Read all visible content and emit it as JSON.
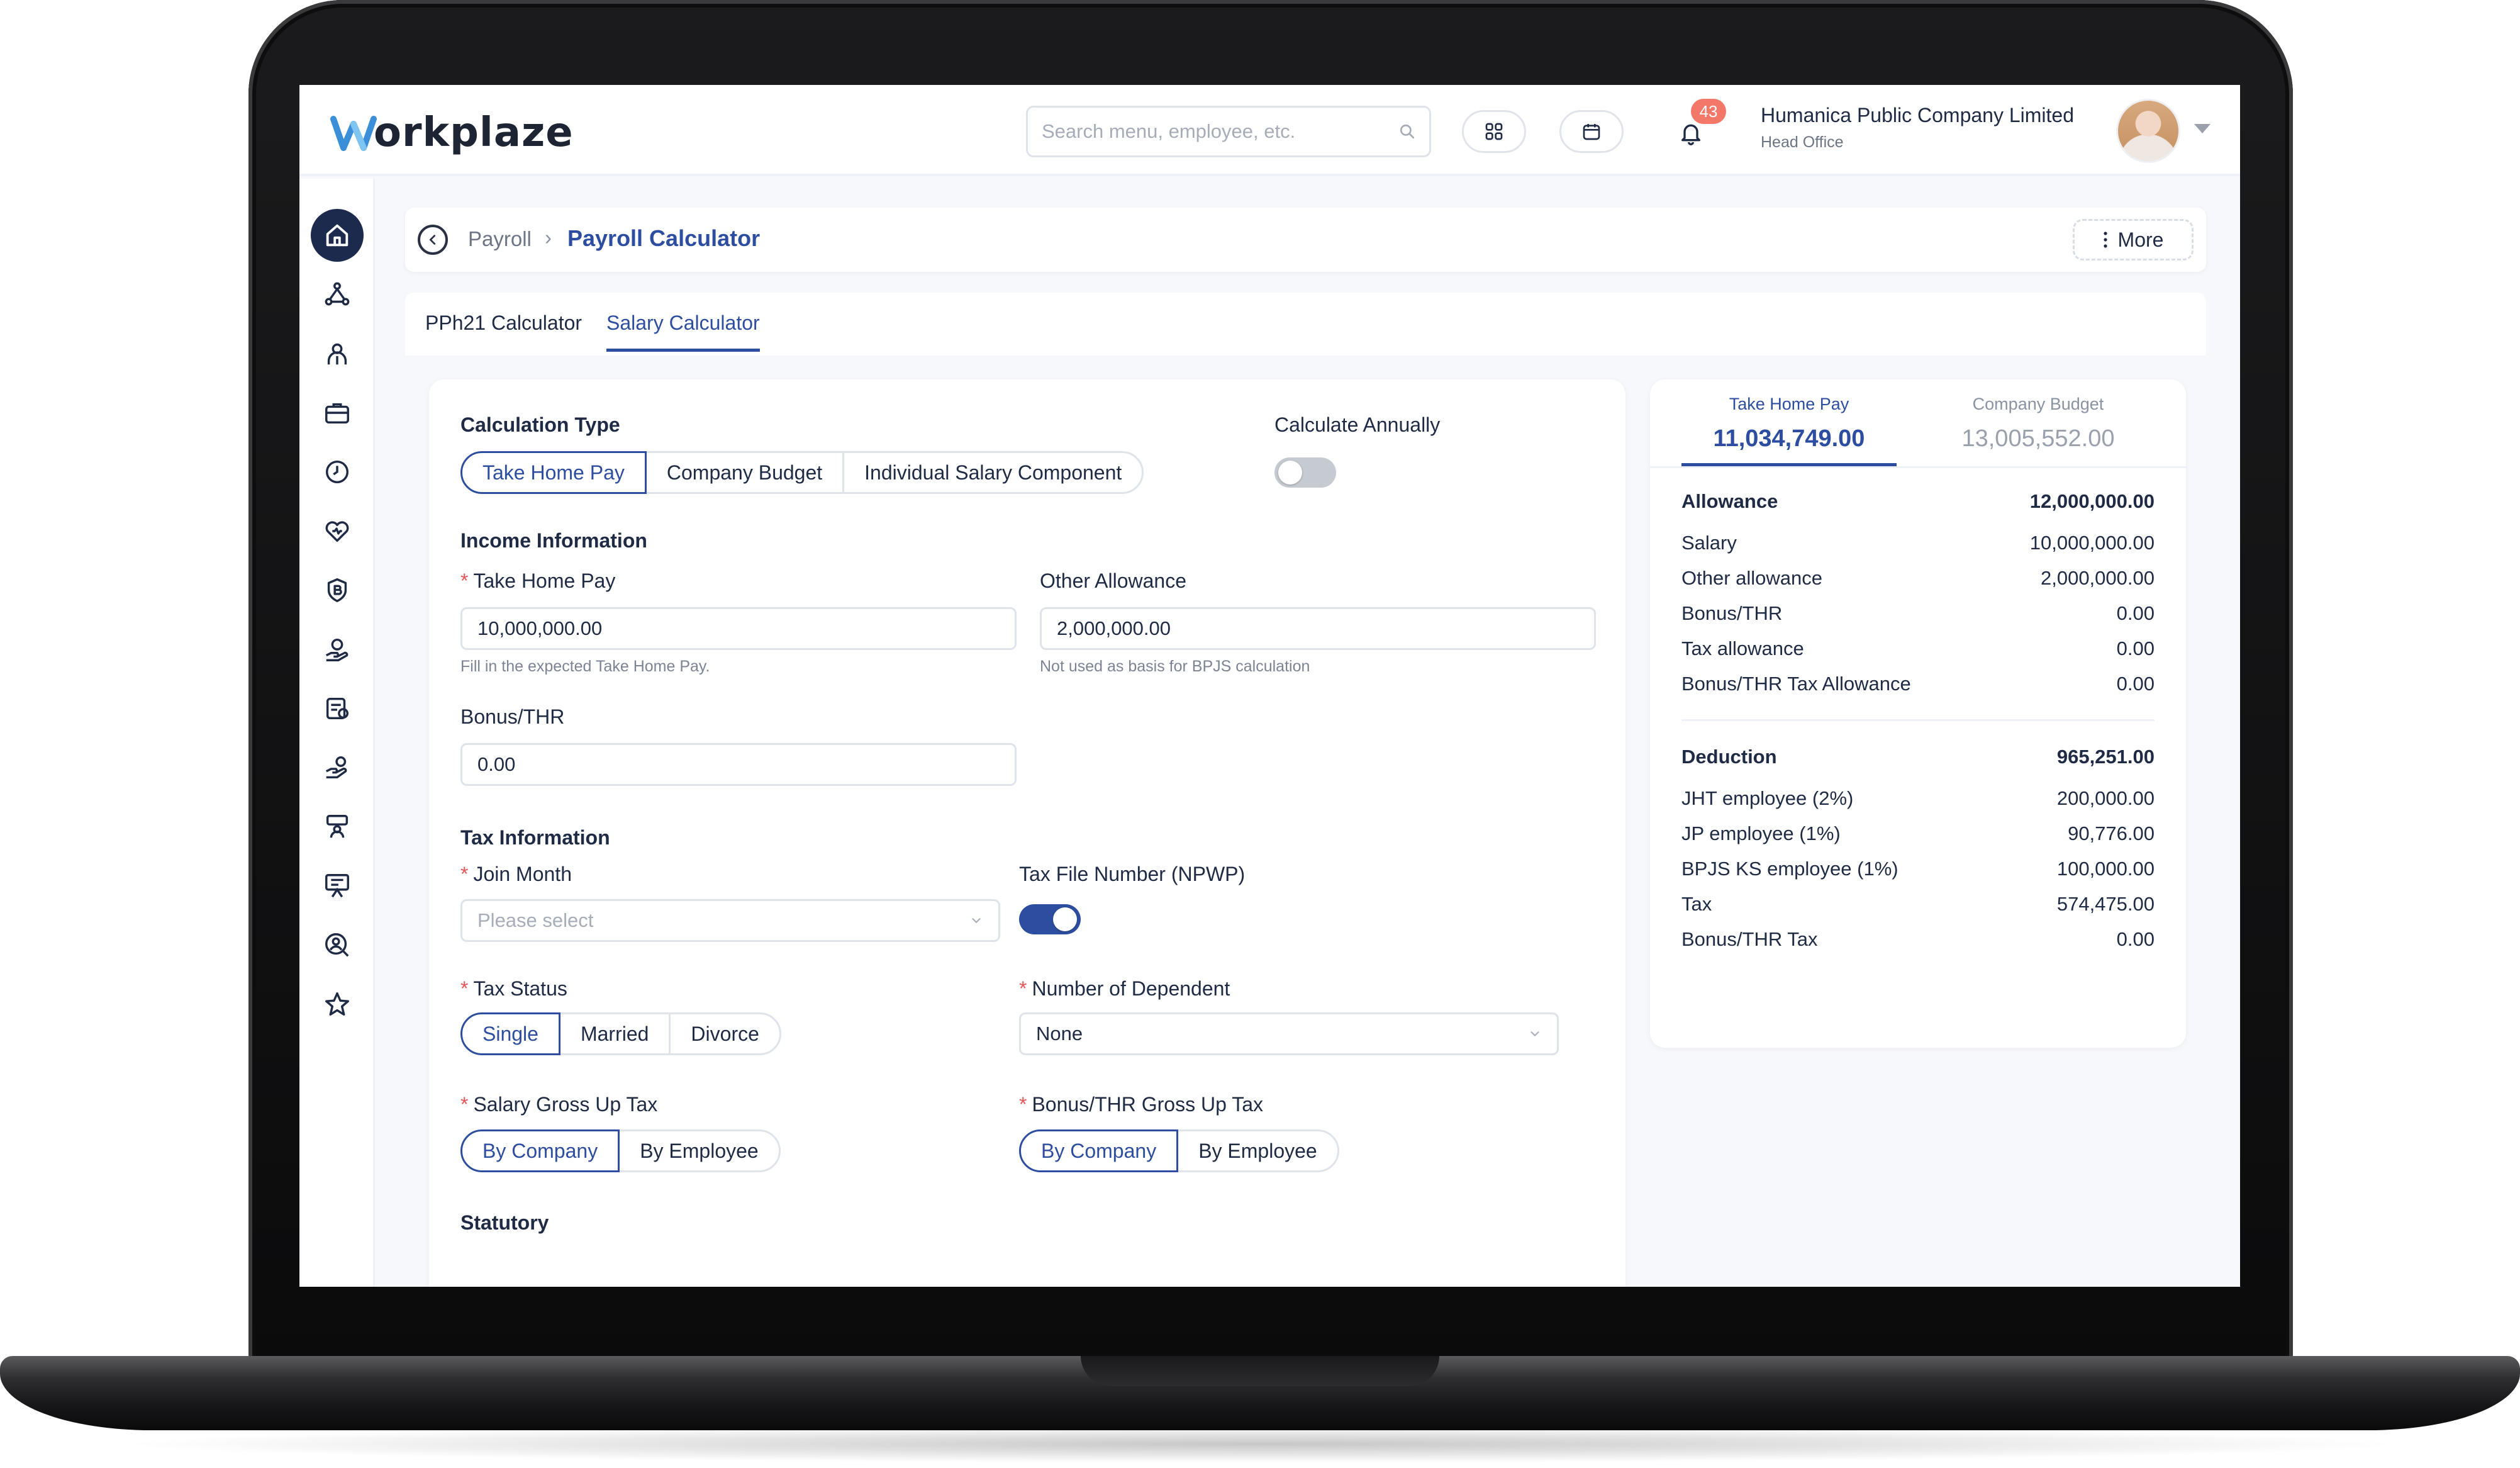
{
  "app": {
    "logo_text": "orkplaze"
  },
  "header": {
    "search_placeholder": "Search menu, employee, etc.",
    "notification_count": "43",
    "company_name": "Humanica Public Company Limited",
    "company_branch": "Head Office"
  },
  "breadcrumb": {
    "parent": "Payroll",
    "separator": "›",
    "current": "Payroll Calculator",
    "more_label": "More"
  },
  "tabs": [
    {
      "label": "PPh21 Calculator",
      "active": false
    },
    {
      "label": "Salary Calculator",
      "active": true
    }
  ],
  "form": {
    "calculation_type": {
      "title": "Calculation Type",
      "options": [
        "Take Home Pay",
        "Company Budget",
        "Individual Salary Component"
      ],
      "selected": "Take Home Pay"
    },
    "calculate_annually": {
      "label": "Calculate Annually",
      "on": false
    },
    "income": {
      "title": "Income Information",
      "take_home_pay": {
        "label": "Take Home Pay",
        "value": "10,000,000.00",
        "helper": "Fill in the expected Take Home Pay."
      },
      "other_allowance": {
        "label": "Other Allowance",
        "value": "2,000,000.00",
        "helper": "Not used as basis for BPJS calculation"
      },
      "bonus_thr": {
        "label": "Bonus/THR",
        "value": "0.00"
      }
    },
    "tax": {
      "title": "Tax Information",
      "join_month": {
        "label": "Join Month",
        "placeholder": "Please select"
      },
      "npwp": {
        "label": "Tax File Number (NPWP)",
        "on": true
      },
      "tax_status": {
        "label": "Tax Status",
        "options": [
          "Single",
          "Married",
          "Divorce"
        ],
        "selected": "Single"
      },
      "dependents": {
        "label": "Number of Dependent",
        "value": "None"
      },
      "salary_gross_up": {
        "label": "Salary Gross Up Tax",
        "options": [
          "By Company",
          "By Employee"
        ],
        "selected": "By Company"
      },
      "bonus_gross_up": {
        "label": "Bonus/THR Gross Up Tax",
        "options": [
          "By Company",
          "By Employee"
        ],
        "selected": "By Company"
      }
    },
    "statutory": {
      "title": "Statutory"
    },
    "required_marker": "*"
  },
  "summary": {
    "tabs": [
      {
        "label": "Take Home Pay",
        "amount": "11,034,749.00",
        "active": true
      },
      {
        "label": "Company Budget",
        "amount": "13,005,552.00",
        "active": false
      }
    ],
    "allowance": {
      "title": "Allowance",
      "total": "12,000,000.00",
      "rows": [
        {
          "label": "Salary",
          "value": "10,000,000.00"
        },
        {
          "label": "Other allowance",
          "value": "2,000,000.00"
        },
        {
          "label": "Bonus/THR",
          "value": "0.00"
        },
        {
          "label": "Tax allowance",
          "value": "0.00"
        },
        {
          "label": "Bonus/THR Tax Allowance",
          "value": "0.00"
        }
      ]
    },
    "deduction": {
      "title": "Deduction",
      "total": "965,251.00",
      "rows": [
        {
          "label": "JHT employee (2%)",
          "value": "200,000.00"
        },
        {
          "label": "JP employee (1%)",
          "value": "90,776.00"
        },
        {
          "label": "BPJS KS employee (1%)",
          "value": "100,000.00"
        },
        {
          "label": "Tax",
          "value": "574,475.00"
        },
        {
          "label": "Bonus/THR Tax",
          "value": "0.00"
        }
      ]
    }
  },
  "colors": {
    "accent": "#2d4ea0",
    "sidebar_active": "#1c2a4d",
    "badge": "#f3786a",
    "logo_blue": "#3b8fd9"
  },
  "sidebar": {
    "icons": [
      "home-icon",
      "org-chart-icon",
      "employee-icon",
      "briefcase-icon",
      "clock-icon",
      "heart-care-icon",
      "shield-b-icon",
      "money-hand-icon",
      "payroll-card-icon",
      "coin-hand-icon",
      "training-icon",
      "presentation-icon",
      "search-user-icon",
      "star-icon"
    ]
  }
}
